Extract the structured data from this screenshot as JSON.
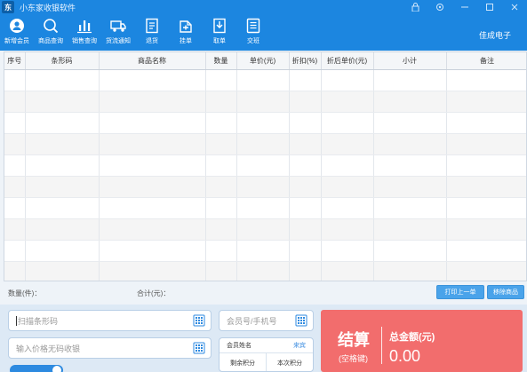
{
  "window": {
    "title": "小东家收银软件",
    "logo_text": "东"
  },
  "toolbar": {
    "items": [
      {
        "label": "新增会员",
        "icon": "add-member-icon"
      },
      {
        "label": "商品查询",
        "icon": "search-icon"
      },
      {
        "label": "销售查询",
        "icon": "bar-chart-icon"
      },
      {
        "label": "货流通知",
        "icon": "truck-icon"
      },
      {
        "label": "退货",
        "icon": "return-icon"
      },
      {
        "label": "挂单",
        "icon": "hold-order-icon"
      },
      {
        "label": "取单",
        "icon": "retrieve-order-icon"
      },
      {
        "label": "交班",
        "icon": "shift-handover-icon"
      }
    ],
    "brand": "佳成电子"
  },
  "grid": {
    "columns": [
      "序号",
      "条形码",
      "商品名称",
      "数量",
      "单价(元)",
      "折扣(%)",
      "折后单价(元)",
      "小计",
      "备注"
    ],
    "rows": 12
  },
  "summary": {
    "quantity_label": "数量(件)：",
    "total_label": "合计(元)：",
    "print_last_button": "打印上一单",
    "remove_item_button": "移除商品"
  },
  "inputs": {
    "barcode_placeholder": "扫描条形码",
    "price_placeholder": "输入价格无码收银",
    "member_placeholder": "会员号/手机号"
  },
  "member": {
    "name_label": "会员姓名",
    "name_value": "来宾",
    "points_left_label": "剩余积分",
    "points_this_label": "本次积分"
  },
  "checkout": {
    "title": "结算",
    "hint": "(空格键)",
    "total_label": "总金额(元)",
    "total_value": "0.00"
  },
  "colors": {
    "primary": "#1c86e0",
    "checkout": "#f26d6d",
    "button": "#4aa3ea"
  }
}
